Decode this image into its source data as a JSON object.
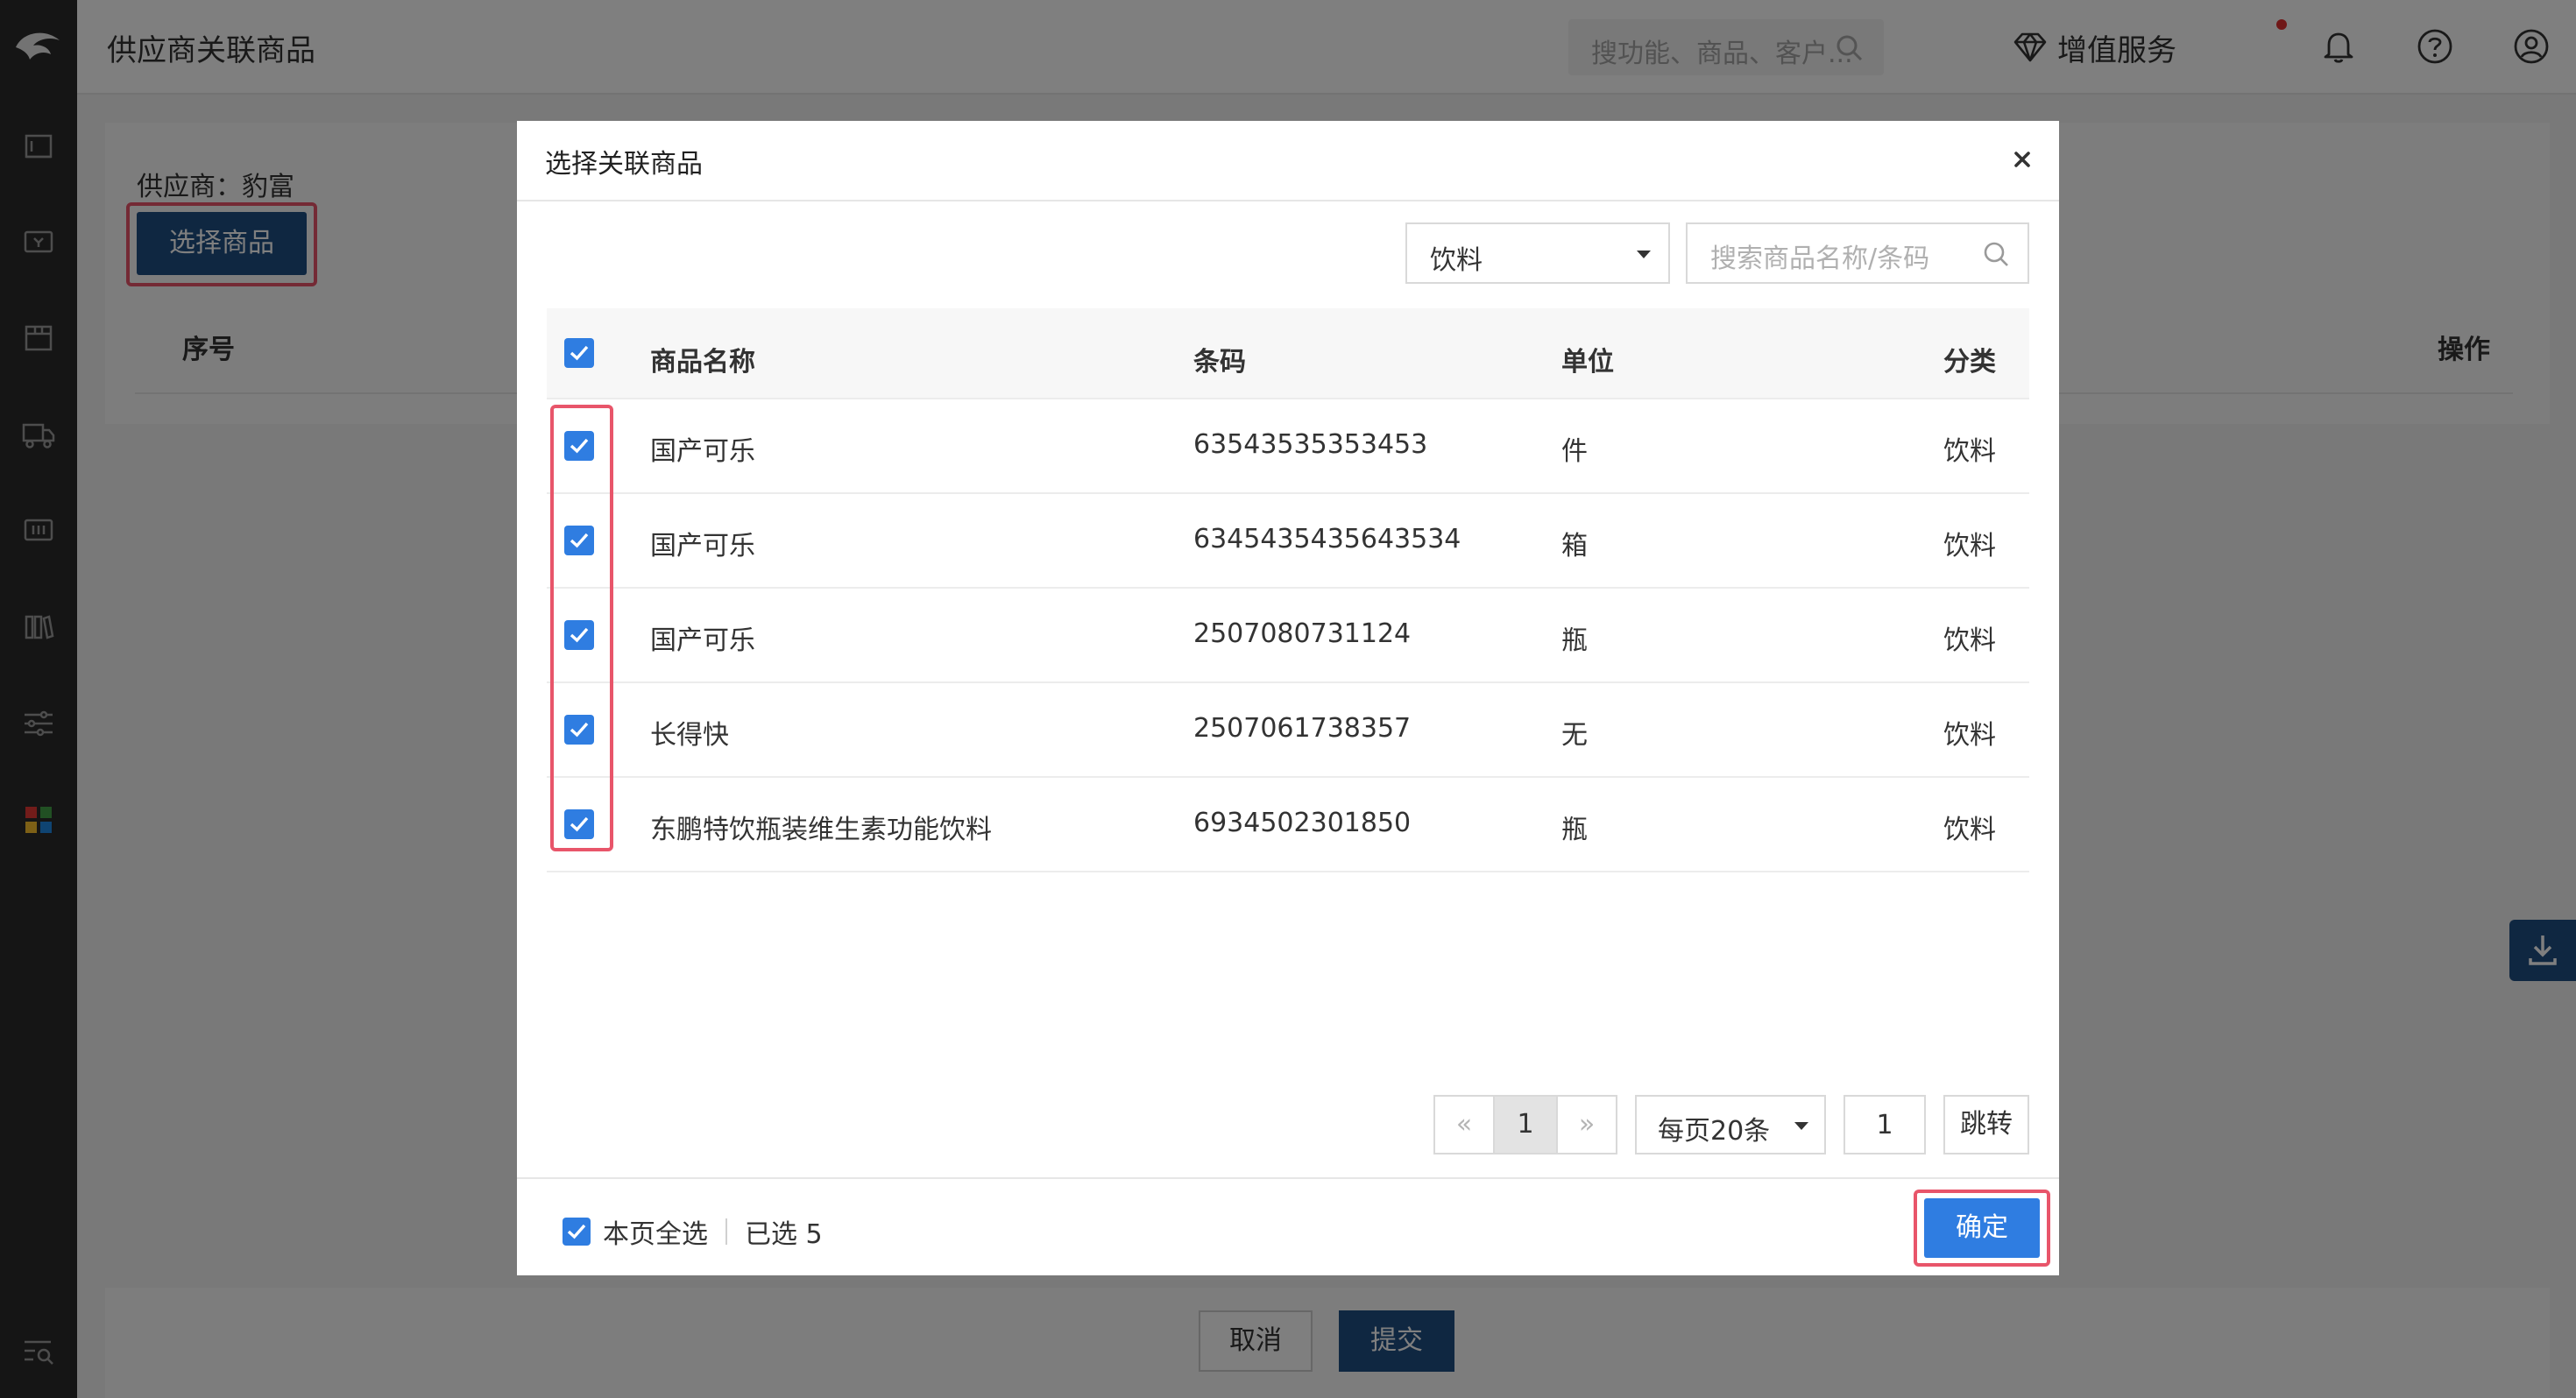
{
  "header": {
    "title": "供应商关联商品",
    "search_placeholder": "搜功能、商品、客户...",
    "vas_label": "增值服务"
  },
  "background": {
    "supplier_label": "供应商：豹富",
    "select_button": "选择商品",
    "table_headers": {
      "seq": "序号",
      "action": "操作"
    },
    "cancel_button": "取消",
    "submit_button": "提交"
  },
  "modal": {
    "title": "选择关联商品",
    "category_value": "饮料",
    "search_placeholder": "搜索商品名称/条码",
    "columns": {
      "name": "商品名称",
      "barcode": "条码",
      "unit": "单位",
      "category": "分类"
    },
    "rows": [
      {
        "name": "国产可乐",
        "barcode": "63543535353453",
        "unit": "件",
        "category": "饮料"
      },
      {
        "name": "国产可乐",
        "barcode": "6345435435643534",
        "unit": "箱",
        "category": "饮料"
      },
      {
        "name": "国产可乐",
        "barcode": "2507080731124",
        "unit": "瓶",
        "category": "饮料"
      },
      {
        "name": "长得快",
        "barcode": "2507061738357",
        "unit": "无",
        "category": "饮料"
      },
      {
        "name": "东鹏特饮瓶装维生素功能饮料",
        "barcode": "6934502301850",
        "unit": "瓶",
        "category": "饮料"
      }
    ],
    "pagination": {
      "prev": "«",
      "current": "1",
      "next": "»",
      "page_size": "每页20条",
      "jump_value": "1",
      "jump_button": "跳转"
    },
    "footer": {
      "select_all": "本页全选",
      "selected_count": "已选 5",
      "confirm_button": "确定"
    }
  },
  "colors": {
    "primary": "#2f7de1",
    "dark_primary": "#1f4f83",
    "highlight": "#e8556a",
    "sidebar": "#2b2b2b"
  }
}
